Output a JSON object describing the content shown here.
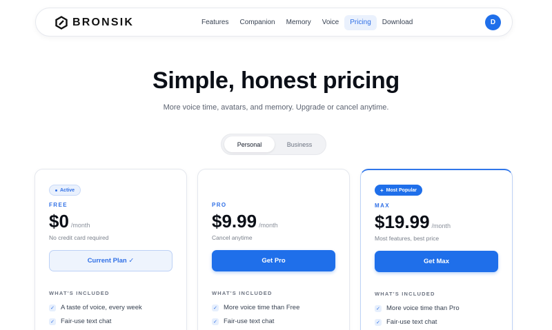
{
  "nav": {
    "brand": "BRONSIK",
    "links": [
      "Features",
      "Companion",
      "Memory",
      "Voice",
      "Pricing",
      "Download"
    ],
    "active_link": "Pricing",
    "avatar_initial": "D"
  },
  "hero": {
    "title": "Simple, honest pricing",
    "subtitle": "More voice time, avatars, and memory. Upgrade or cancel anytime."
  },
  "toggle": {
    "options": [
      "Personal",
      "Business"
    ],
    "selected": "Personal"
  },
  "plans": [
    {
      "badge": "Active",
      "tier": "FREE",
      "price": "$0",
      "period": "/month",
      "note": "No credit card required",
      "cta": "Current Plan ✓",
      "included_label": "WHAT'S INCLUDED",
      "features": [
        "A taste of voice, every week",
        "Fair-use text chat"
      ]
    },
    {
      "badge": "",
      "tier": "PRO",
      "price": "$9.99",
      "period": "/month",
      "note": "Cancel anytime",
      "cta": "Get Pro",
      "included_label": "WHAT'S INCLUDED",
      "features": [
        "More voice time than Free",
        "Fair-use text chat"
      ]
    },
    {
      "badge": "Most Popular",
      "tier": "MAX",
      "price": "$19.99",
      "period": "/month",
      "note": "Most features, best price",
      "cta": "Get Max",
      "included_label": "WHAT'S INCLUDED",
      "features": [
        "More voice time than Pro",
        "Fair-use text chat"
      ]
    }
  ],
  "colors": {
    "accent": "#1f6fea",
    "accent_light": "#eaf1fd",
    "text": "#0b0f17"
  }
}
